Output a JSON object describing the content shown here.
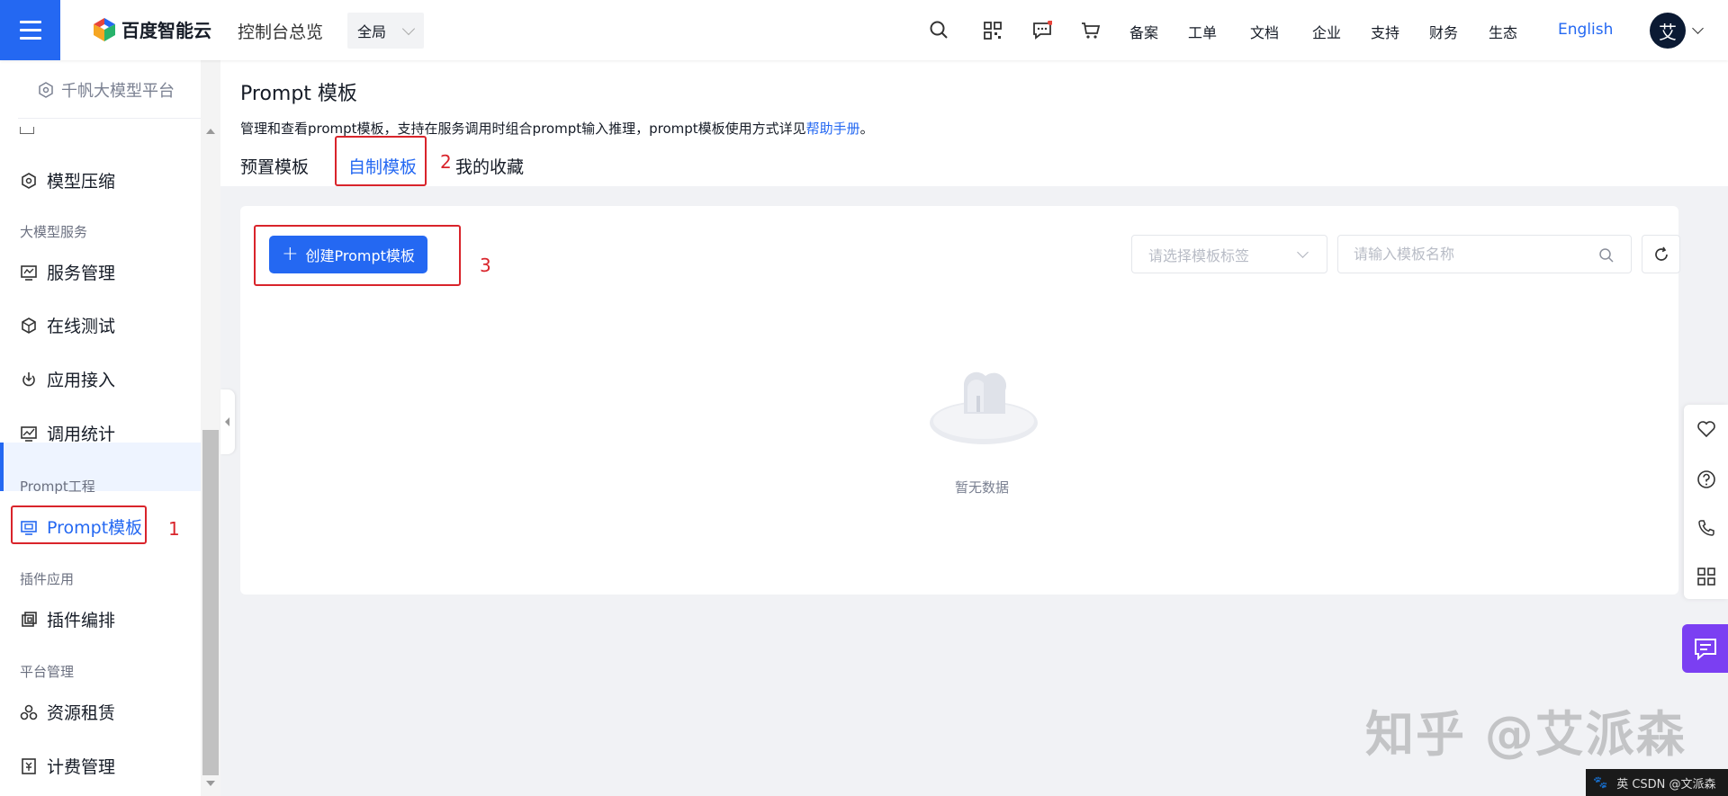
{
  "topbar": {
    "logo_text": "百度智能云",
    "console_link": "控制台总览",
    "region_value": "全局",
    "nav_links": [
      "备案",
      "工单",
      "文档",
      "企业",
      "支持",
      "财务",
      "生态"
    ],
    "language": "English",
    "avatar_letter": "艾",
    "brand_color": "#2468f2"
  },
  "sidebar": {
    "platform_title": "千帆大模型平台",
    "items_top": [
      {
        "label": "模型压缩",
        "icon": "compress-icon"
      }
    ],
    "groups": [
      {
        "title": "大模型服务",
        "items": [
          {
            "label": "服务管理",
            "icon": "service-icon"
          },
          {
            "label": "在线测试",
            "icon": "test-icon"
          },
          {
            "label": "应用接入",
            "icon": "access-icon"
          },
          {
            "label": "调用统计",
            "icon": "stats-icon"
          }
        ]
      },
      {
        "title": "Prompt工程",
        "items": [
          {
            "label": "Prompt模板",
            "icon": "template-icon",
            "active": true
          }
        ]
      },
      {
        "title": "插件应用",
        "items": [
          {
            "label": "插件编排",
            "icon": "plugin-icon"
          }
        ]
      },
      {
        "title": "平台管理",
        "items": [
          {
            "label": "资源租赁",
            "icon": "resource-icon"
          },
          {
            "label": "计费管理",
            "icon": "billing-icon"
          }
        ]
      }
    ]
  },
  "annotations": [
    "1",
    "2",
    "3"
  ],
  "main": {
    "title": "Prompt 模板",
    "description": "管理和查看prompt模板，支持在服务调用时组合prompt输入推理，prompt模板使用方式详见",
    "help_link": "帮助手册",
    "desc_end": "。",
    "tabs": [
      {
        "label": "预置模板",
        "active": false
      },
      {
        "label": "自制模板",
        "active": true
      },
      {
        "label": "我的收藏",
        "active": false
      }
    ],
    "create_button": "创建Prompt模板",
    "tag_select_placeholder": "请选择模板标签",
    "search_placeholder": "请输入模板名称",
    "empty_text": "暂无数据"
  },
  "watermark": "知乎 @艾派森",
  "ime_bar": "英 CSDN @文派森"
}
